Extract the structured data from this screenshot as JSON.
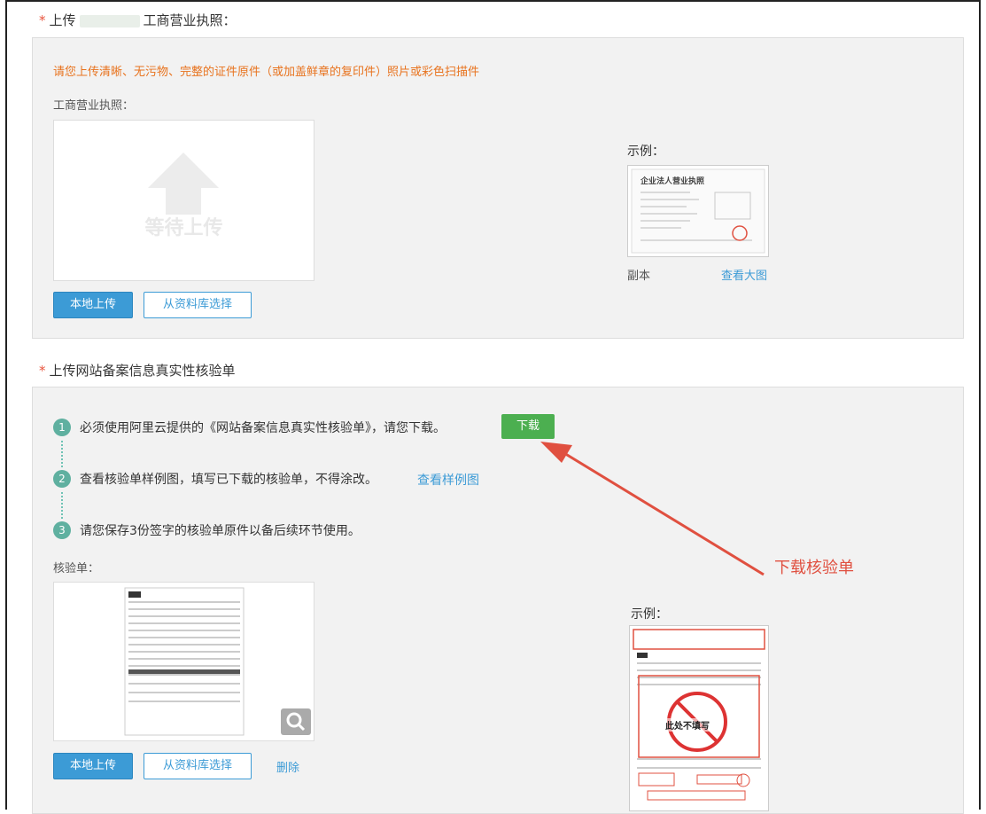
{
  "section1": {
    "required_mark": "*",
    "title_prefix": "上传",
    "title_suffix": "工商营业执照：",
    "notice": "请您上传清晰、无污物、完整的证件原件（或加盖鲜章的复印件）照片或彩色扫描件",
    "field_label": "工商营业执照：",
    "placeholder_text": "等待上传",
    "local_upload": "本地上传",
    "library_select": "从资料库选择",
    "example_label": "示例：",
    "example_doc_title": "企业法人营业执照",
    "copy_label": "副本",
    "view_large": "查看大图"
  },
  "section2": {
    "required_mark": "*",
    "title": "上传网站备案信息真实性核验单",
    "steps": [
      {
        "num": "1",
        "text": "必须使用阿里云提供的《网站备案信息真实性核验单》，请您下载。"
      },
      {
        "num": "2",
        "text": "查看核验单样例图，填写已下载的核验单，不得涂改。"
      },
      {
        "num": "3",
        "text": "请您保存3份签字的核验单原件以备后续环节使用。"
      }
    ],
    "download_button": "下载",
    "view_sample_link": "查看样例图",
    "field_label": "核验单：",
    "local_upload": "本地上传",
    "library_select": "从资料库选择",
    "delete_link": "删除",
    "example_label": "示例：",
    "example_stamp_text": "此处不填写"
  },
  "annotation": {
    "text": "下载核验单",
    "color": "#e05040"
  },
  "colors": {
    "primary": "#3c9bd6",
    "download_green": "#4caf50",
    "notice_orange": "#e8731e",
    "required_red": "#e8553e"
  }
}
